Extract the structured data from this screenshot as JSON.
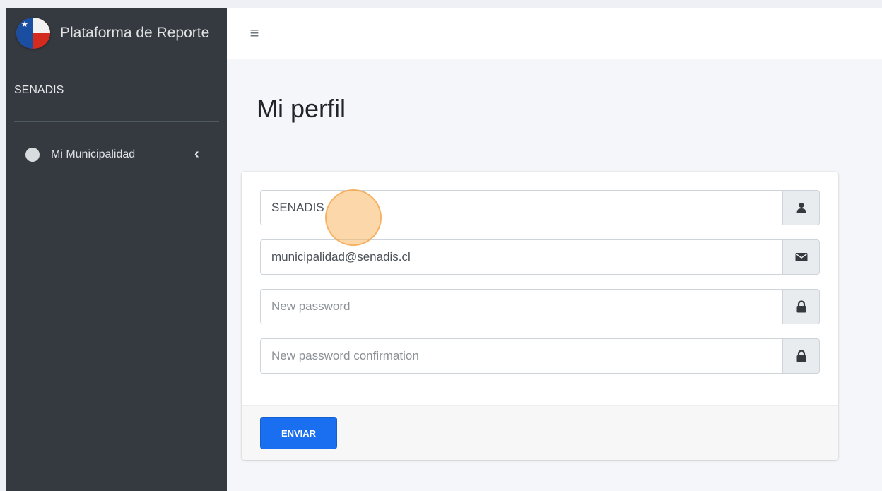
{
  "brand": {
    "title": "Plataforma de Reporte"
  },
  "sidebar": {
    "user_name": "SENADIS",
    "items": [
      {
        "label": "Mi Municipalidad"
      }
    ]
  },
  "page": {
    "title": "Mi perfil"
  },
  "form": {
    "name_value": "SENADIS",
    "email_value": "municipalidad@senadis.cl",
    "password_placeholder": "New password",
    "password_confirmation_placeholder": "New password confirmation",
    "submit_label": "ENVIAR"
  },
  "icons": {
    "menu": "hamburger-menu-icon",
    "user": "user-icon",
    "email": "envelope-icon",
    "password": "lock-icon",
    "collapse": "chevron-left-icon",
    "nav_item": "circle-icon"
  },
  "colors": {
    "sidebar_bg": "#343a40",
    "primary_button": "#1a6ff0",
    "cursor_highlight": "#f9b765"
  }
}
